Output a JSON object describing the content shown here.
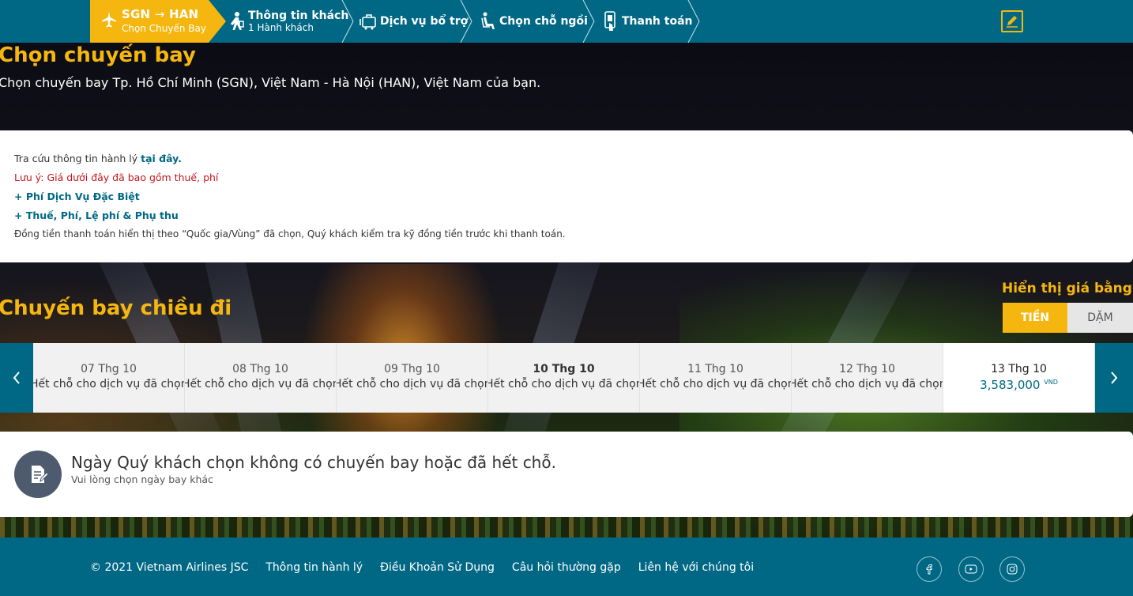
{
  "steps": {
    "flight": {
      "origin": "SGN",
      "destination": "HAN",
      "arrow": "→",
      "label": "Chọn Chuyến Bay",
      "icon": "plane-icon"
    },
    "passengers": {
      "label": "Thông tin khách",
      "sub": "1 Hành khách",
      "icon": "passenger-icon"
    },
    "services": {
      "label": "Dịch vụ bổ trợ",
      "icon": "baggage-icon"
    },
    "seats": {
      "label": "Chọn chỗ ngồi",
      "icon": "seat-icon"
    },
    "payment": {
      "label": "Thanh toán",
      "icon": "payment-icon"
    },
    "edit_icon": "pencil-icon"
  },
  "header": {
    "title": "Chọn chuyến bay",
    "subtitle": "Chọn chuyến bay Tp. Hồ Chí Minh (SGN), Việt Nam - Hà Nội (HAN), Việt Nam của bạn."
  },
  "info": {
    "baggage_prefix": "Tra cứu thông tin hành lý",
    "baggage_link": "tại đây.",
    "note": "Lưu ý: Giá dưới đây đã bao gồm thuế, phí",
    "special_fee": "+ Phí Dịch Vụ Đặc Biệt",
    "taxes": "+ Thuế, Phí, Lệ phí & Phụ thu",
    "currency_note": "Đồng tiền thanh toán hiển thị theo “Quốc gia/Vùng” đã chọn, Quý khách kiểm tra kỹ đồng tiền trước khi thanh toán."
  },
  "outbound": {
    "title": "Chuyến bay chiều đi",
    "price_mode_label": "Hiển thị giá bằng",
    "money": "TIỀN",
    "miles": "DẶM"
  },
  "dates": [
    {
      "date": "07 Thg 10",
      "status": "Hết chỗ cho dịch vụ đã chọn"
    },
    {
      "date": "08 Thg 10",
      "status": "Hết chỗ cho dịch vụ đã chọn"
    },
    {
      "date": "09 Thg 10",
      "status": "Hết chỗ cho dịch vụ đã chọn"
    },
    {
      "date": "10 Thg 10",
      "status": "Hết chỗ cho dịch vụ đã chọn"
    },
    {
      "date": "11 Thg 10",
      "status": "Hết chỗ cho dịch vụ đã chọn"
    },
    {
      "date": "12 Thg 10",
      "status": "Hết chỗ cho dịch vụ đã chọn"
    },
    {
      "date": "13 Thg 10",
      "price": "3,583,000",
      "currency": "VND"
    }
  ],
  "no_flight": {
    "message": "Ngày Quý khách chọn không có chuyến bay hoặc đã hết chỗ.",
    "hint": "Vui lòng chọn ngày bay khác",
    "icon": "document-edit-icon"
  },
  "footer": {
    "copyright": "© 2021 Vietnam Airlines JSC",
    "baggage": "Thông tin hành lý",
    "terms": "Điều Khoản Sử Dụng",
    "faq": "Câu hỏi thường gặp",
    "contact": "Liên hệ với chúng tôi",
    "social": [
      "facebook-icon",
      "youtube-icon",
      "instagram-icon"
    ]
  },
  "colors": {
    "brand_teal": "#006885",
    "accent_gold": "#f5b70f",
    "warning_red": "#c4161c"
  }
}
